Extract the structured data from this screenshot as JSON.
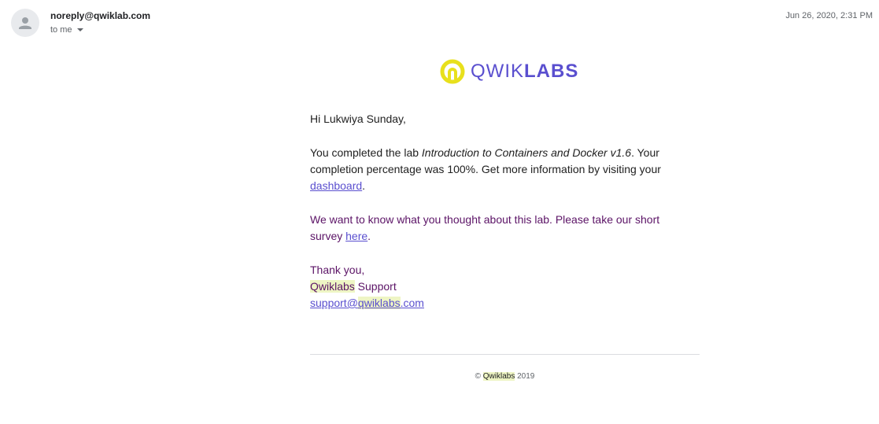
{
  "header": {
    "sender": "noreply@qwiklab.com",
    "recipient": "to me",
    "timestamp": "Jun 26, 2020, 2:31 PM"
  },
  "logo": {
    "name_light": "QWIK",
    "name_bold": "LABS",
    "mark_color": "#e8e01c",
    "brand_color": "#5a4fcf"
  },
  "body": {
    "greeting": "Hi Lukwiya Sunday,",
    "completed_prefix": "You completed the lab ",
    "lab_title": "Introduction to Containers and Docker v1.6",
    "completed_suffix": ". Your completion percentage was 100%. Get more information by visiting your ",
    "dashboard_link": "dashboard",
    "period": ".",
    "survey_text": "We want to know what you thought about this lab. Please take our short survey ",
    "survey_link": "here",
    "thanks": "Thank you,",
    "support_brand": "Qwiklabs",
    "support_word": " Support",
    "email_prefix": "support@",
    "email_domain": "qwiklabs",
    "email_tld": ".com"
  },
  "footer": {
    "copyright_symbol": "©",
    "brand": "Qwiklabs",
    "year": "2019"
  }
}
